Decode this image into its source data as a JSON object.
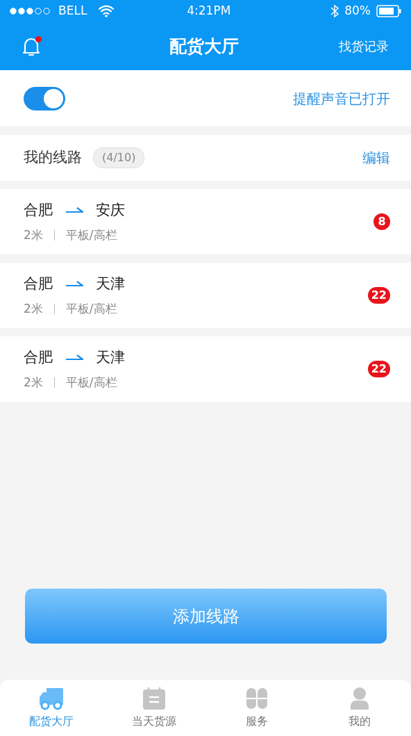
{
  "status_bar": {
    "carrier": "BELL",
    "time": "4:21PM",
    "battery": "80%"
  },
  "header": {
    "title": "配货大厅",
    "action": "找货记录",
    "has_notification": true
  },
  "alert": {
    "on": true,
    "label": "提醒声音已打开"
  },
  "routes_header": {
    "title": "我的线路",
    "count": "(4/10)",
    "action": "编辑"
  },
  "routes": [
    {
      "from": "合肥",
      "to": "安庆",
      "size": "2米",
      "truck_type": "平板/高栏",
      "count": "8"
    },
    {
      "from": "合肥",
      "to": "天津",
      "size": "2米",
      "truck_type": "平板/高栏",
      "count": "22"
    },
    {
      "from": "合肥",
      "to": "天津",
      "size": "2米",
      "truck_type": "平板/高栏",
      "count": "22"
    }
  ],
  "add_button": "添加线路",
  "tabs": [
    {
      "kind": "truck",
      "label": "配货大厅",
      "selected": true
    },
    {
      "kind": "calendar",
      "label": "当天货源",
      "selected": false
    },
    {
      "kind": "grid",
      "label": "服务",
      "selected": false
    },
    {
      "kind": "person",
      "label": "我的",
      "selected": false
    }
  ]
}
